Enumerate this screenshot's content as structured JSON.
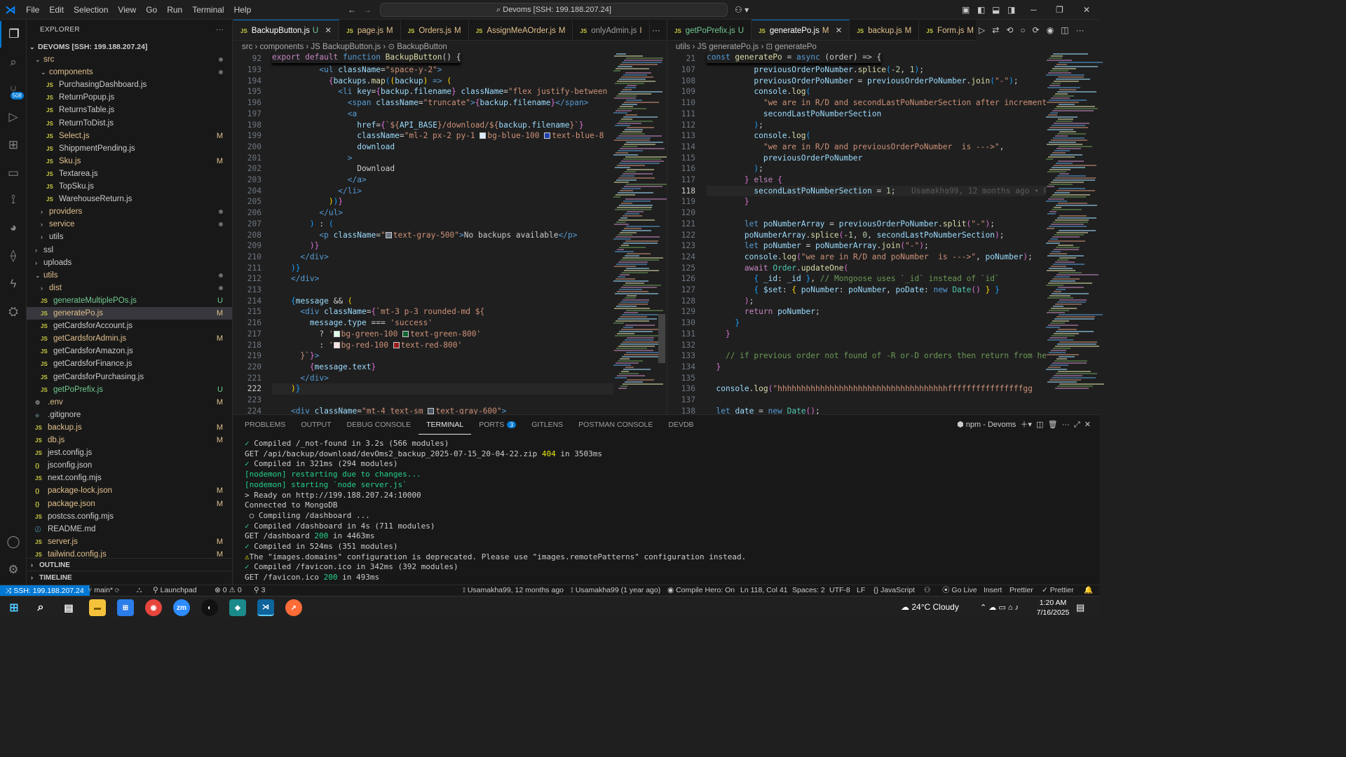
{
  "menu": [
    "File",
    "Edit",
    "Selection",
    "View",
    "Go",
    "Run",
    "Terminal",
    "Help"
  ],
  "command_center": "Devoms [SSH: 199.188.207.24]",
  "activity": {
    "scm_badge": "508"
  },
  "explorer": {
    "title": "EXPLORER",
    "root": "DEVOMS [SSH: 199.188.207.24]",
    "items": [
      {
        "label": "src",
        "kind": "folder",
        "open": true,
        "indent": 1,
        "dot": true
      },
      {
        "label": "components",
        "kind": "folder",
        "open": true,
        "indent": 2,
        "dot": true
      },
      {
        "label": "PurchasingDashboard.js",
        "kind": "file",
        "indent": 3
      },
      {
        "label": "ReturnPopup.js",
        "kind": "file",
        "indent": 3
      },
      {
        "label": "ReturnsTable.js",
        "kind": "file",
        "indent": 3
      },
      {
        "label": "ReturnToDist.js",
        "kind": "file",
        "indent": 3
      },
      {
        "label": "Select.js",
        "kind": "file",
        "indent": 3,
        "status": "M"
      },
      {
        "label": "ShippmentPending.js",
        "kind": "file",
        "indent": 3
      },
      {
        "label": "Sku.js",
        "kind": "file",
        "indent": 3,
        "status": "M"
      },
      {
        "label": "Textarea.js",
        "kind": "file",
        "indent": 3
      },
      {
        "label": "TopSku.js",
        "kind": "file",
        "indent": 3
      },
      {
        "label": "WarehouseReturn.js",
        "kind": "file",
        "indent": 3
      },
      {
        "label": "providers",
        "kind": "folder",
        "open": false,
        "indent": 2,
        "dot": true
      },
      {
        "label": "service",
        "kind": "folder",
        "open": false,
        "indent": 2,
        "dot": true
      },
      {
        "label": "utils",
        "kind": "folder",
        "open": false,
        "indent": 2
      },
      {
        "label": "ssl",
        "kind": "folder",
        "open": false,
        "indent": 1
      },
      {
        "label": "uploads",
        "kind": "folder",
        "open": false,
        "indent": 1
      },
      {
        "label": "utils",
        "kind": "folder",
        "open": true,
        "indent": 1,
        "dot": true
      },
      {
        "label": "dist",
        "kind": "folder",
        "open": false,
        "indent": 2,
        "dot": true
      },
      {
        "label": "generateMultiplePOs.js",
        "kind": "file",
        "indent": 2,
        "status": "U"
      },
      {
        "label": "generatePo.js",
        "kind": "file",
        "indent": 2,
        "status": "M",
        "selected": true
      },
      {
        "label": "getCardsforAccount.js",
        "kind": "file",
        "indent": 2
      },
      {
        "label": "getCardsforAdmin.js",
        "kind": "file",
        "indent": 2,
        "status": "M"
      },
      {
        "label": "getCardsforAmazon.js",
        "kind": "file",
        "indent": 2
      },
      {
        "label": "getCardsforFinance.js",
        "kind": "file",
        "indent": 2
      },
      {
        "label": "getCardsforPurchasing.js",
        "kind": "file",
        "indent": 2
      },
      {
        "label": "getPoPrefix.js",
        "kind": "file",
        "indent": 2,
        "status": "U"
      },
      {
        "label": ".env",
        "kind": "gear",
        "indent": 1,
        "status": "M"
      },
      {
        "label": ".gitignore",
        "kind": "git",
        "indent": 1
      },
      {
        "label": "backup.js",
        "kind": "file",
        "indent": 1,
        "status": "M"
      },
      {
        "label": "db.js",
        "kind": "file",
        "indent": 1,
        "status": "M"
      },
      {
        "label": "jest.config.js",
        "kind": "file",
        "indent": 1
      },
      {
        "label": "jsconfig.json",
        "kind": "json",
        "indent": 1
      },
      {
        "label": "next.config.mjs",
        "kind": "file",
        "indent": 1
      },
      {
        "label": "package-lock.json",
        "kind": "json",
        "indent": 1,
        "status": "M"
      },
      {
        "label": "package.json",
        "kind": "json",
        "indent": 1,
        "status": "M"
      },
      {
        "label": "postcss.config.mjs",
        "kind": "file",
        "indent": 1
      },
      {
        "label": "README.md",
        "kind": "info",
        "indent": 1
      },
      {
        "label": "server.js",
        "kind": "file",
        "indent": 1,
        "status": "M"
      },
      {
        "label": "tailwind.config.js",
        "kind": "file",
        "indent": 1,
        "status": "M"
      }
    ],
    "outline": "OUTLINE",
    "timeline": "TIMELINE"
  },
  "editor1": {
    "tabs": [
      {
        "label": "BackupButton.js",
        "status": "U",
        "active": true,
        "close": true
      },
      {
        "label": "page.js",
        "status": "M"
      },
      {
        "label": "Orders.js",
        "status": "M"
      },
      {
        "label": "AssignMeAOrder.js",
        "status": "M"
      },
      {
        "label": "onlyAdmin.js",
        "status": "I"
      }
    ],
    "breadcrumb": "src  ›  components  ›  JS BackupButton.js  ›  ⊙ BackupButton",
    "sticky": {
      "num": "92",
      "text": "export default function BackupButton() {"
    },
    "lines": [
      {
        "n": "193",
        "h": "          <span class='tg'>&lt;ul</span> <span class='attr'>className</span>=<span class='str'>\"space-y-2\"</span><span class='tg'>&gt;</span>"
      },
      {
        "n": "194",
        "h": "            <span class='br2'>{</span><span class='var'>backups</span>.<span class='fn'>map</span><span class='br3'>(</span><span class='br'>(</span><span class='var'>backup</span><span class='br'>)</span> <span class='kw'>=&gt;</span> <span class='br'>(</span>"
      },
      {
        "n": "195",
        "h": "              <span class='tg'>&lt;li</span> <span class='attr'>key</span>=<span class='br2'>{</span><span class='var'>backup</span>.<span class='var'>filename</span><span class='br2'>}</span> <span class='attr'>className</span>=<span class='str'>\"flex justify-between</span>"
      },
      {
        "n": "196",
        "h": "                <span class='tg'>&lt;span</span> <span class='attr'>className</span>=<span class='str'>\"truncate\"</span><span class='tg'>&gt;</span><span class='br2'>{</span><span class='var'>backup</span>.<span class='var'>filename</span><span class='br2'>}</span><span class='tg'>&lt;/span&gt;</span>"
      },
      {
        "n": "197",
        "h": "                <span class='tg'>&lt;a</span>"
      },
      {
        "n": "198",
        "h": "                  <span class='attr'>href</span>=<span class='br2'>{</span><span class='str'>`${</span><span class='var'>API_BASE</span><span class='str'>}/download/${</span><span class='var'>backup</span>.<span class='var'>filename</span><span class='str'>}`</span><span class='br2'>}</span>"
      },
      {
        "n": "199",
        "h": "                  <span class='attr'>className</span>=<span class='str'>\"ml-2 px-2 py-1 <span class='sw' style='background:#dbeafe'></span>bg-blue-100 <span class='sw' style='background:#1e40af'></span>text-blue-8</span>"
      },
      {
        "n": "200",
        "h": "                  <span class='attr'>download</span>"
      },
      {
        "n": "201",
        "h": "                <span class='tg'>&gt;</span>"
      },
      {
        "n": "202",
        "h": "                  Download"
      },
      {
        "n": "203",
        "h": "                <span class='tg'>&lt;/a&gt;</span>"
      },
      {
        "n": "204",
        "h": "              <span class='tg'>&lt;/li&gt;</span>"
      },
      {
        "n": "205",
        "h": "            <span class='br'>)</span><span class='br3'>)</span><span class='br2'>}</span>"
      },
      {
        "n": "206",
        "h": "          <span class='tg'>&lt;/ul&gt;</span>"
      },
      {
        "n": "207",
        "h": "        <span class='br3'>)</span> : <span class='br3'>(</span>"
      },
      {
        "n": "208",
        "h": "          <span class='tg'>&lt;p</span> <span class='attr'>className</span>=<span class='str'>\"<span class='sw' style='background:#6b7280'></span>text-gray-500\"</span><span class='tg'>&gt;</span>No backups available<span class='tg'>&lt;/p&gt;</span>"
      },
      {
        "n": "209",
        "h": "        <span class='br2'>)}</span>"
      },
      {
        "n": "210",
        "h": "      <span class='tg'>&lt;/div&gt;</span>"
      },
      {
        "n": "211",
        "h": "    <span class='br3'>)}</span>"
      },
      {
        "n": "212",
        "h": "    <span class='tg'>&lt;/div&gt;</span>"
      },
      {
        "n": "213",
        "h": ""
      },
      {
        "n": "214",
        "h": "    <span class='br3'>{</span><span class='var'>message</span> &amp;&amp; <span class='br'>(</span>"
      },
      {
        "n": "215",
        "h": "      <span class='tg'>&lt;div</span> <span class='attr'>className</span>=<span class='br2'>{</span><span class='str'>`mt-3 p-3 rounded-md ${</span>"
      },
      {
        "n": "216",
        "h": "        <span class='var'>message</span>.<span class='var'>type</span> === <span class='str'>'success'</span>"
      },
      {
        "n": "217",
        "h": "          ? <span class='str'>'<span class='sw' style='background:#dcfce7'></span>bg-green-100 <span class='sw' style='background:#166534'></span>text-green-800'</span>"
      },
      {
        "n": "218",
        "h": "          : <span class='str'>'<span class='sw' style='background:#fee2e2'></span>bg-red-100 <span class='sw' style='background:#991b1b'></span>text-red-800'</span>"
      },
      {
        "n": "219",
        "h": "      <span class='str'>}`</span><span class='br2'>}</span><span class='tg'>&gt;</span>"
      },
      {
        "n": "220",
        "h": "        <span class='br2'>{</span><span class='var'>message</span>.<span class='var'>text</span><span class='br2'>}</span>"
      },
      {
        "n": "221",
        "h": "      <span class='tg'>&lt;/div&gt;</span>"
      },
      {
        "n": "222",
        "h": "    <span class='br'>)</span><span class='br3'>}</span>",
        "cur": true
      },
      {
        "n": "223",
        "h": ""
      },
      {
        "n": "224",
        "h": "    <span class='tg'>&lt;div</span> <span class='attr'>className</span>=<span class='str'>\"mt-4 text-sm <span class='sw' style='background:#4b5563'></span>text-gray-600\"</span><span class='tg'>&gt;</span>"
      }
    ]
  },
  "editor2": {
    "tabs": [
      {
        "label": "getPoPrefix.js",
        "status": "U"
      },
      {
        "label": "generatePo.js",
        "status": "M",
        "active": true,
        "close": true
      },
      {
        "label": "backup.js",
        "status": "M"
      },
      {
        "label": "Form.js",
        "status": "M"
      }
    ],
    "breadcrumb": "utils  ›  JS generatePo.js  ›  ⊡ generatePo",
    "sticky": {
      "num": "21",
      "text": "const generatePo = async (order) => {"
    },
    "blame": "Usamakha99, 12 months ago • P",
    "lines": [
      {
        "n": "107",
        "h": "          <span class='var'>previousOrderPoNumber</span>.<span class='fn'>splice</span><span class='br3'>(</span>-<span class='num'>2</span>, <span class='num'>1</span><span class='br3'>)</span>;"
      },
      {
        "n": "108",
        "h": "          <span class='var'>previousOrderPoNumber</span> = <span class='var'>previousOrderPoNumber</span>.<span class='fn'>join</span><span class='br3'>(</span><span class='str'>\"-\"</span><span class='br3'>)</span>;"
      },
      {
        "n": "109",
        "h": "          <span class='var'>console</span>.<span class='fn'>log</span><span class='br3'>(</span>"
      },
      {
        "n": "110",
        "h": "            <span class='str'>\"we are in R/D and secondLastPoNumberSection after increment is</span>"
      },
      {
        "n": "111",
        "h": "            <span class='var'>secondLastPoNumberSection</span>"
      },
      {
        "n": "112",
        "h": "          <span class='br3'>)</span>;"
      },
      {
        "n": "113",
        "h": "          <span class='var'>console</span>.<span class='fn'>log</span><span class='br3'>(</span>"
      },
      {
        "n": "114",
        "h": "            <span class='str'>\"we are in R/D and previousOrderPoNumber  is ---&gt;\"</span>,"
      },
      {
        "n": "115",
        "h": "            <span class='var'>previousOrderPoNumber</span>"
      },
      {
        "n": "116",
        "h": "          <span class='br3'>)</span>;"
      },
      {
        "n": "117",
        "h": "        <span class='br2'>}</span> <span class='kw2'>else</span> <span class='br2'>{</span>"
      },
      {
        "n": "118",
        "h": "          <span class='var'>secondLastPoNumberSection</span> = <span class='num'>1</span>;",
        "cur": true
      },
      {
        "n": "119",
        "h": "        <span class='br2'>}</span>"
      },
      {
        "n": "120",
        "h": ""
      },
      {
        "n": "121",
        "h": "        <span class='kw'>let</span> <span class='var'>poNumberArray</span> = <span class='var'>previousOrderPoNumber</span>.<span class='fn'>split</span><span class='br2'>(</span><span class='str'>\"-\"</span><span class='br2'>)</span>;"
      },
      {
        "n": "122",
        "h": "        <span class='var'>poNumberArray</span>.<span class='fn'>splice</span><span class='br2'>(</span>-<span class='num'>1</span>, <span class='num'>0</span>, <span class='var'>secondLastPoNumberSection</span><span class='br2'>)</span>;"
      },
      {
        "n": "123",
        "h": "        <span class='kw'>let</span> <span class='var'>poNumber</span> = <span class='var'>poNumberArray</span>.<span class='fn'>join</span><span class='br2'>(</span><span class='str'>\"-\"</span><span class='br2'>)</span>;"
      },
      {
        "n": "124",
        "h": "        <span class='var'>console</span>.<span class='fn'>log</span><span class='br2'>(</span><span class='str'>\"we are in R/D and poNumber  is ---&gt;\"</span>, <span class='var'>poNumber</span><span class='br2'>)</span>;"
      },
      {
        "n": "125",
        "h": "        <span class='kw2'>await</span> <span class='tag'>Order</span>.<span class='fn'>updateOne</span><span class='br2'>(</span>"
      },
      {
        "n": "126",
        "h": "          <span class='br3'>{</span> <span class='var'>_id</span>: <span class='var'>_id</span> <span class='br3'>}</span>, <span class='cm'>// Mongoose uses `_id` instead of `id`</span>"
      },
      {
        "n": "127",
        "h": "          <span class='br3'>{</span> <span class='var'>$set</span>: <span class='br'>{</span> <span class='var'>poNumber</span>: <span class='var'>poNumber</span>, <span class='var'>poDate</span>: <span class='kw'>new</span> <span class='tag'>Date</span><span class='br2'>()</span> <span class='br'>}</span> <span class='br3'>}</span>"
      },
      {
        "n": "128",
        "h": "        <span class='br2'>)</span>;"
      },
      {
        "n": "129",
        "h": "        <span class='kw2'>return</span> <span class='var'>poNumber</span>;"
      },
      {
        "n": "130",
        "h": "      <span class='br3'>}</span>"
      },
      {
        "n": "131",
        "h": "    <span class='br2'>}</span>"
      },
      {
        "n": "132",
        "h": ""
      },
      {
        "n": "133",
        "h": "    <span class='cm'>// if previous order not found of -R or-D orders then return from here i</span>"
      },
      {
        "n": "134",
        "h": "  <span class='br2'>}</span>"
      },
      {
        "n": "135",
        "h": ""
      },
      {
        "n": "136",
        "h": "  <span class='var'>console</span>.<span class='fn'>log</span><span class='br2'>(</span><span class='str'>\"hhhhhhhhhhhhhhhhhhhhhhhhhhhhhhhhhhhhffffffffffffffffgg</span>"
      },
      {
        "n": "137",
        "h": ""
      },
      {
        "n": "138",
        "h": "  <span class='kw'>let</span> <span class='var'>date</span> = <span class='kw'>new</span> <span class='tag'>Date</span><span class='br2'>()</span>;"
      }
    ]
  },
  "panel": {
    "tabs": [
      "PROBLEMS",
      "OUTPUT",
      "DEBUG CONSOLE",
      "TERMINAL",
      "PORTS",
      "GITLENS",
      "POSTMAN CONSOLE",
      "DEVDB"
    ],
    "active": "TERMINAL",
    "ports_badge": "3",
    "terminal_name": "npm - Devoms",
    "lines": [
      "<span class='ok'>✓</span> Compiled /_not-found in 3.2s (566 modules)",
      "GET /api/backup/download/devOms2_backup_2025-07-15_20-04-22.zip <span class='yellow'>404</span> in 3503ms",
      "<span class='ok'>✓</span> Compiled in 321ms (294 modules)",
      "<span class='green'>[nodemon] restarting due to changes...</span>",
      "<span class='green'>[nodemon] starting `node server.js`</span>",
      "&gt; Ready on http://199.188.207.24:10000",
      "Connected to MongoDB",
      " ○ Compiling /dashboard ...",
      "<span class='ok'>✓</span> Compiled /dashboard in 4s (711 modules)",
      "GET /dashboard <span class='green'>200</span> in 4463ms",
      "<span class='ok'>✓</span> Compiled in 524ms (351 modules)",
      "<span class='yellow'>⚠</span>The \"images.domains\" configuration is deprecated. Please use \"images.remotePatterns\" configuration instead.",
      "<span class='ok'>✓</span> Compiled /favicon.ico in 342ms (392 modules)",
      "GET /favicon.ico <span class='green'>200</span> in 493ms"
    ]
  },
  "status": {
    "remote": "SSH: 199.188.207.24",
    "branch": "main*",
    "launchpad": "Launchpad",
    "errors": "0",
    "warnings": "0",
    "ports": "3",
    "blame1": "Usamakha99, 12 months ago",
    "blame2": "Usamakha99 (1 year ago)",
    "compile": "Compile Hero: On",
    "cursor": "Ln 118, Col 41",
    "spaces": "Spaces: 2",
    "encoding": "UTF-8",
    "eol": "LF",
    "lang": "JavaScript",
    "golive": "Go Live",
    "insert": "Insert",
    "prettier1": "Prettier",
    "prettier2": "Prettier"
  },
  "taskbar": {
    "weather": "24°C  Cloudy",
    "time": "1:20 AM",
    "date": "7/16/2025"
  }
}
